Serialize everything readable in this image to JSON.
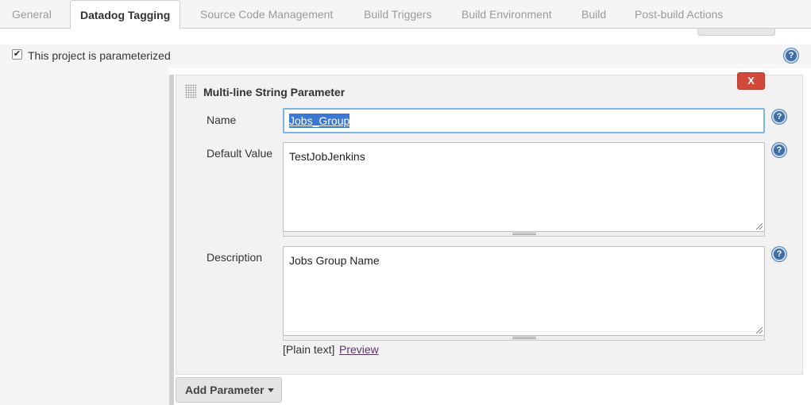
{
  "tabs": [
    {
      "label": "General"
    },
    {
      "label": "Datadog Tagging"
    },
    {
      "label": "Source Code Management"
    },
    {
      "label": "Build Triggers"
    },
    {
      "label": "Build Environment"
    },
    {
      "label": "Build"
    },
    {
      "label": "Post-build Actions"
    }
  ],
  "active_tab": "Datadog Tagging",
  "parameterized": {
    "label": "This project is parameterized",
    "checked": true,
    "check_glyph": "✔"
  },
  "help_glyph": "?",
  "parameter": {
    "title": "Multi-line String Parameter",
    "delete_label": "X",
    "name_label": "Name",
    "name_value": "Jobs_Group",
    "default_label": "Default Value",
    "default_value": "TestJobJenkins",
    "description_label": "Description",
    "description_value": "Jobs Group Name",
    "plain_text": "[Plain text]",
    "preview_link": "Preview"
  },
  "add_parameter": {
    "label": "Add Parameter"
  },
  "colors": {
    "delete_button": "#d24939",
    "help_icon": "#3f6fa6",
    "selection": "#3a78d4",
    "link": "#5c3566"
  }
}
